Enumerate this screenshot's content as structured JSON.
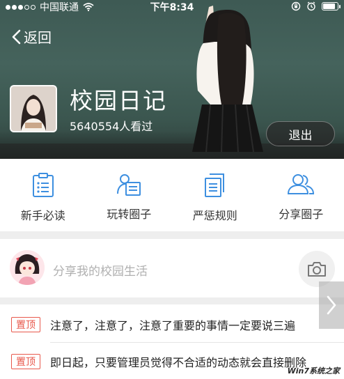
{
  "status_bar": {
    "signal_dots_filled": 3,
    "signal_dots_total": 5,
    "carrier": "中国联通",
    "time": "下午8:34",
    "battery_level": 0.9
  },
  "header": {
    "back_label": "返回",
    "title": "校园日记",
    "views": "5640554人看过",
    "exit_label": "退出"
  },
  "menu": {
    "items": [
      {
        "label": "新手必读",
        "icon": "document-list-icon"
      },
      {
        "label": "玩转圈子",
        "icon": "person-card-icon"
      },
      {
        "label": "严惩规则",
        "icon": "copy-document-icon"
      },
      {
        "label": "分享圈子",
        "icon": "group-users-icon"
      }
    ]
  },
  "share": {
    "placeholder": "分享我的校园生活",
    "camera_icon": "camera-icon"
  },
  "posts": [
    {
      "badge": "置顶",
      "text": "注意了，注意了，注意了重要的事情一定要说三遍"
    },
    {
      "badge": "置顶",
      "text": "即日起，只要管理员觉得不合适的动态就会直接删除"
    }
  ],
  "colors": {
    "accent_blue": "#3d8fe0",
    "badge_red": "#e8584c"
  },
  "watermark": "Win7系统之家"
}
